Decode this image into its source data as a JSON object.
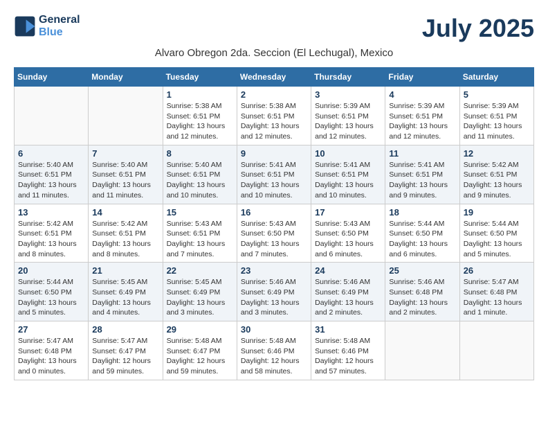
{
  "header": {
    "logo_line1": "General",
    "logo_line2": "Blue",
    "month_year": "July 2025",
    "location": "Alvaro Obregon 2da. Seccion (El Lechugal), Mexico"
  },
  "days_of_week": [
    "Sunday",
    "Monday",
    "Tuesday",
    "Wednesday",
    "Thursday",
    "Friday",
    "Saturday"
  ],
  "weeks": [
    [
      {
        "day": "",
        "info": ""
      },
      {
        "day": "",
        "info": ""
      },
      {
        "day": "1",
        "info": "Sunrise: 5:38 AM\nSunset: 6:51 PM\nDaylight: 13 hours\nand 12 minutes."
      },
      {
        "day": "2",
        "info": "Sunrise: 5:38 AM\nSunset: 6:51 PM\nDaylight: 13 hours\nand 12 minutes."
      },
      {
        "day": "3",
        "info": "Sunrise: 5:39 AM\nSunset: 6:51 PM\nDaylight: 13 hours\nand 12 minutes."
      },
      {
        "day": "4",
        "info": "Sunrise: 5:39 AM\nSunset: 6:51 PM\nDaylight: 13 hours\nand 12 minutes."
      },
      {
        "day": "5",
        "info": "Sunrise: 5:39 AM\nSunset: 6:51 PM\nDaylight: 13 hours\nand 11 minutes."
      }
    ],
    [
      {
        "day": "6",
        "info": "Sunrise: 5:40 AM\nSunset: 6:51 PM\nDaylight: 13 hours\nand 11 minutes."
      },
      {
        "day": "7",
        "info": "Sunrise: 5:40 AM\nSunset: 6:51 PM\nDaylight: 13 hours\nand 11 minutes."
      },
      {
        "day": "8",
        "info": "Sunrise: 5:40 AM\nSunset: 6:51 PM\nDaylight: 13 hours\nand 10 minutes."
      },
      {
        "day": "9",
        "info": "Sunrise: 5:41 AM\nSunset: 6:51 PM\nDaylight: 13 hours\nand 10 minutes."
      },
      {
        "day": "10",
        "info": "Sunrise: 5:41 AM\nSunset: 6:51 PM\nDaylight: 13 hours\nand 10 minutes."
      },
      {
        "day": "11",
        "info": "Sunrise: 5:41 AM\nSunset: 6:51 PM\nDaylight: 13 hours\nand 9 minutes."
      },
      {
        "day": "12",
        "info": "Sunrise: 5:42 AM\nSunset: 6:51 PM\nDaylight: 13 hours\nand 9 minutes."
      }
    ],
    [
      {
        "day": "13",
        "info": "Sunrise: 5:42 AM\nSunset: 6:51 PM\nDaylight: 13 hours\nand 8 minutes."
      },
      {
        "day": "14",
        "info": "Sunrise: 5:42 AM\nSunset: 6:51 PM\nDaylight: 13 hours\nand 8 minutes."
      },
      {
        "day": "15",
        "info": "Sunrise: 5:43 AM\nSunset: 6:51 PM\nDaylight: 13 hours\nand 7 minutes."
      },
      {
        "day": "16",
        "info": "Sunrise: 5:43 AM\nSunset: 6:50 PM\nDaylight: 13 hours\nand 7 minutes."
      },
      {
        "day": "17",
        "info": "Sunrise: 5:43 AM\nSunset: 6:50 PM\nDaylight: 13 hours\nand 6 minutes."
      },
      {
        "day": "18",
        "info": "Sunrise: 5:44 AM\nSunset: 6:50 PM\nDaylight: 13 hours\nand 6 minutes."
      },
      {
        "day": "19",
        "info": "Sunrise: 5:44 AM\nSunset: 6:50 PM\nDaylight: 13 hours\nand 5 minutes."
      }
    ],
    [
      {
        "day": "20",
        "info": "Sunrise: 5:44 AM\nSunset: 6:50 PM\nDaylight: 13 hours\nand 5 minutes."
      },
      {
        "day": "21",
        "info": "Sunrise: 5:45 AM\nSunset: 6:49 PM\nDaylight: 13 hours\nand 4 minutes."
      },
      {
        "day": "22",
        "info": "Sunrise: 5:45 AM\nSunset: 6:49 PM\nDaylight: 13 hours\nand 3 minutes."
      },
      {
        "day": "23",
        "info": "Sunrise: 5:46 AM\nSunset: 6:49 PM\nDaylight: 13 hours\nand 3 minutes."
      },
      {
        "day": "24",
        "info": "Sunrise: 5:46 AM\nSunset: 6:49 PM\nDaylight: 13 hours\nand 2 minutes."
      },
      {
        "day": "25",
        "info": "Sunrise: 5:46 AM\nSunset: 6:48 PM\nDaylight: 13 hours\nand 2 minutes."
      },
      {
        "day": "26",
        "info": "Sunrise: 5:47 AM\nSunset: 6:48 PM\nDaylight: 13 hours\nand 1 minute."
      }
    ],
    [
      {
        "day": "27",
        "info": "Sunrise: 5:47 AM\nSunset: 6:48 PM\nDaylight: 13 hours\nand 0 minutes."
      },
      {
        "day": "28",
        "info": "Sunrise: 5:47 AM\nSunset: 6:47 PM\nDaylight: 12 hours\nand 59 minutes."
      },
      {
        "day": "29",
        "info": "Sunrise: 5:48 AM\nSunset: 6:47 PM\nDaylight: 12 hours\nand 59 minutes."
      },
      {
        "day": "30",
        "info": "Sunrise: 5:48 AM\nSunset: 6:46 PM\nDaylight: 12 hours\nand 58 minutes."
      },
      {
        "day": "31",
        "info": "Sunrise: 5:48 AM\nSunset: 6:46 PM\nDaylight: 12 hours\nand 57 minutes."
      },
      {
        "day": "",
        "info": ""
      },
      {
        "day": "",
        "info": ""
      }
    ]
  ]
}
